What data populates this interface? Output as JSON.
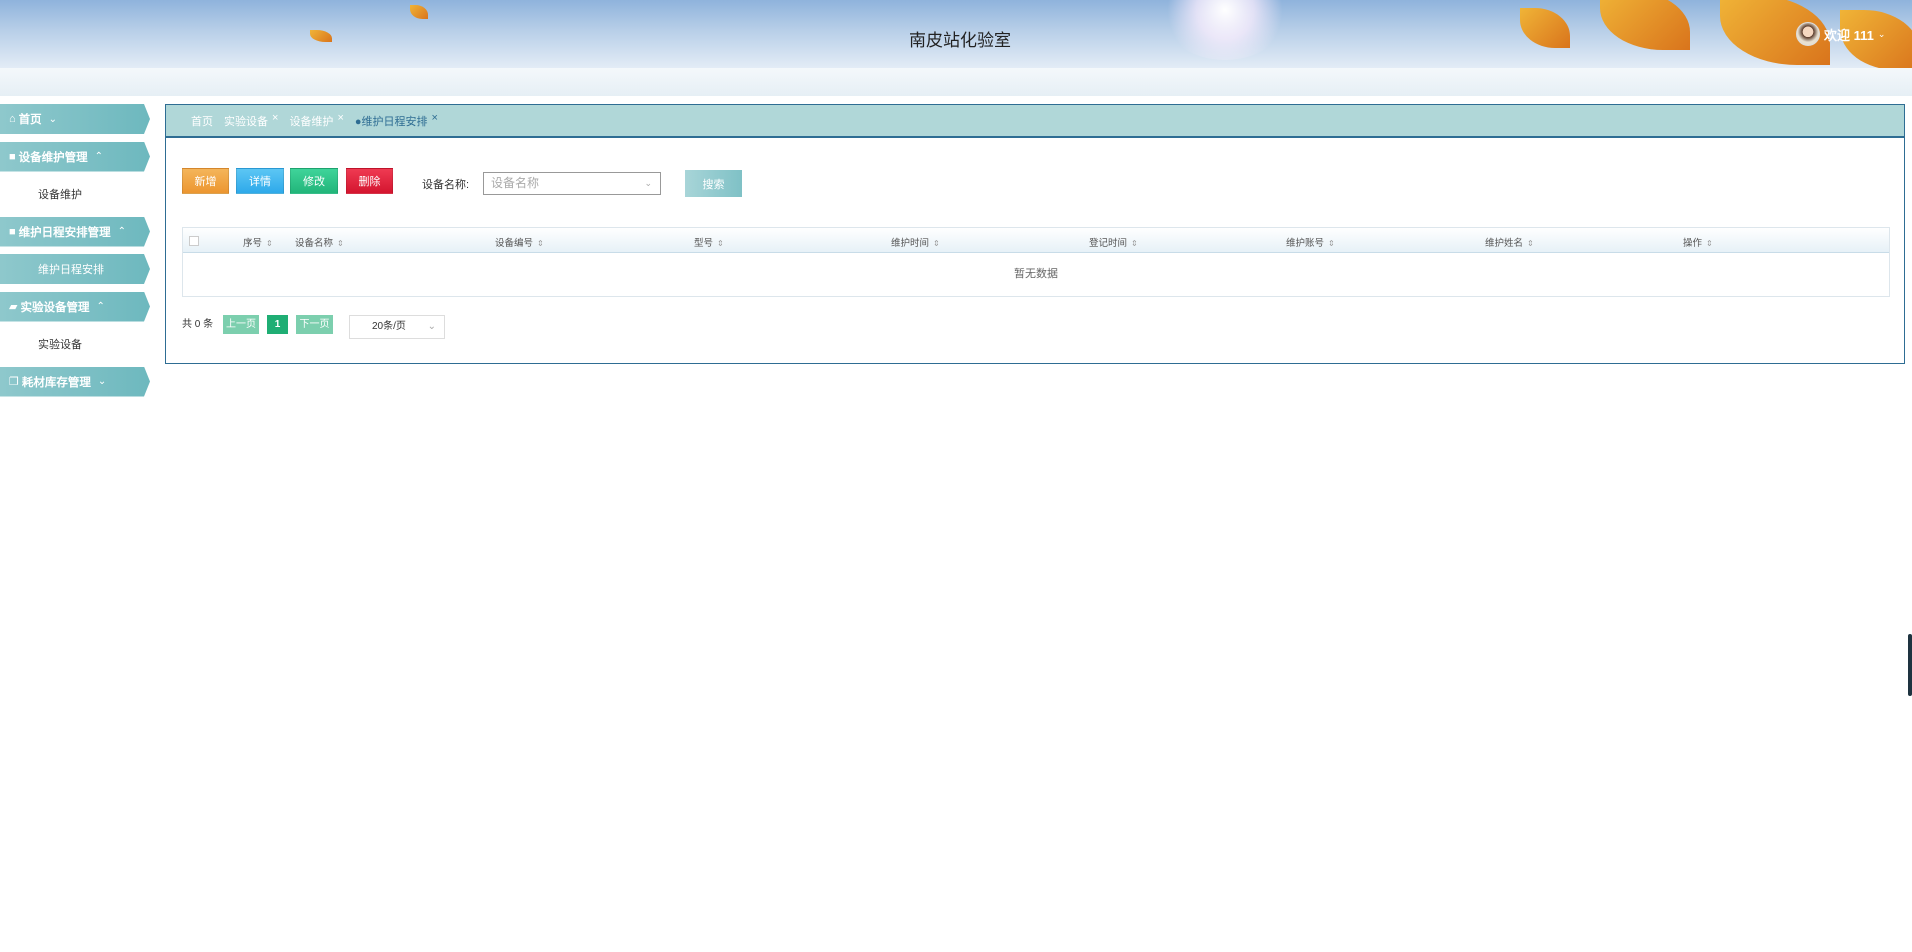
{
  "header": {
    "title": "南皮站化验室",
    "welcome": "欢迎 111"
  },
  "sidebar": [
    {
      "type": "nav",
      "icon": "home-icon",
      "glyph": "⌂",
      "label": "首页",
      "chevron": "⌄"
    },
    {
      "type": "nav",
      "icon": "grid-icon",
      "glyph": "■",
      "label": "设备维护管理",
      "chevron": "⌃"
    },
    {
      "type": "sub",
      "label": "设备维护"
    },
    {
      "type": "nav",
      "icon": "grid-icon",
      "glyph": "■",
      "label": "维护日程安排管理",
      "chevron": "⌃"
    },
    {
      "type": "sub",
      "label": "维护日程安排",
      "active": true
    },
    {
      "type": "nav",
      "icon": "car-icon",
      "glyph": "▰",
      "label": "实验设备管理",
      "chevron": "⌃"
    },
    {
      "type": "sub",
      "label": "实验设备"
    },
    {
      "type": "nav",
      "icon": "copy-icon",
      "glyph": "❐",
      "label": "耗材库存管理",
      "chevron": "⌄"
    }
  ],
  "tabs": [
    {
      "label": "首页"
    },
    {
      "label": "实验设备",
      "close": "×"
    },
    {
      "label": "设备维护",
      "close": "×"
    },
    {
      "label": "●维护日程安排",
      "close": "×",
      "current": true
    }
  ],
  "toolbar": {
    "add": "新增",
    "detail": "详情",
    "edit": "修改",
    "delete": "删除",
    "filter_label": "设备名称:",
    "filter_placeholder": "设备名称",
    "search": "搜索"
  },
  "table": {
    "columns": [
      "序号",
      "设备名称",
      "设备编号",
      "型号",
      "维护时间",
      "登记时间",
      "维护账号",
      "维护姓名",
      "操作"
    ],
    "empty": "暂无数据"
  },
  "pagination": {
    "total": "共 0 条",
    "prev": "上一页",
    "current": "1",
    "next": "下一页",
    "page_size": "20条/页"
  },
  "colors": {
    "add": "#f0a43e",
    "detail": "#3fb6ef",
    "edit": "#2fc58a",
    "delete": "#e0213a",
    "teal": "#7fc1c6"
  }
}
